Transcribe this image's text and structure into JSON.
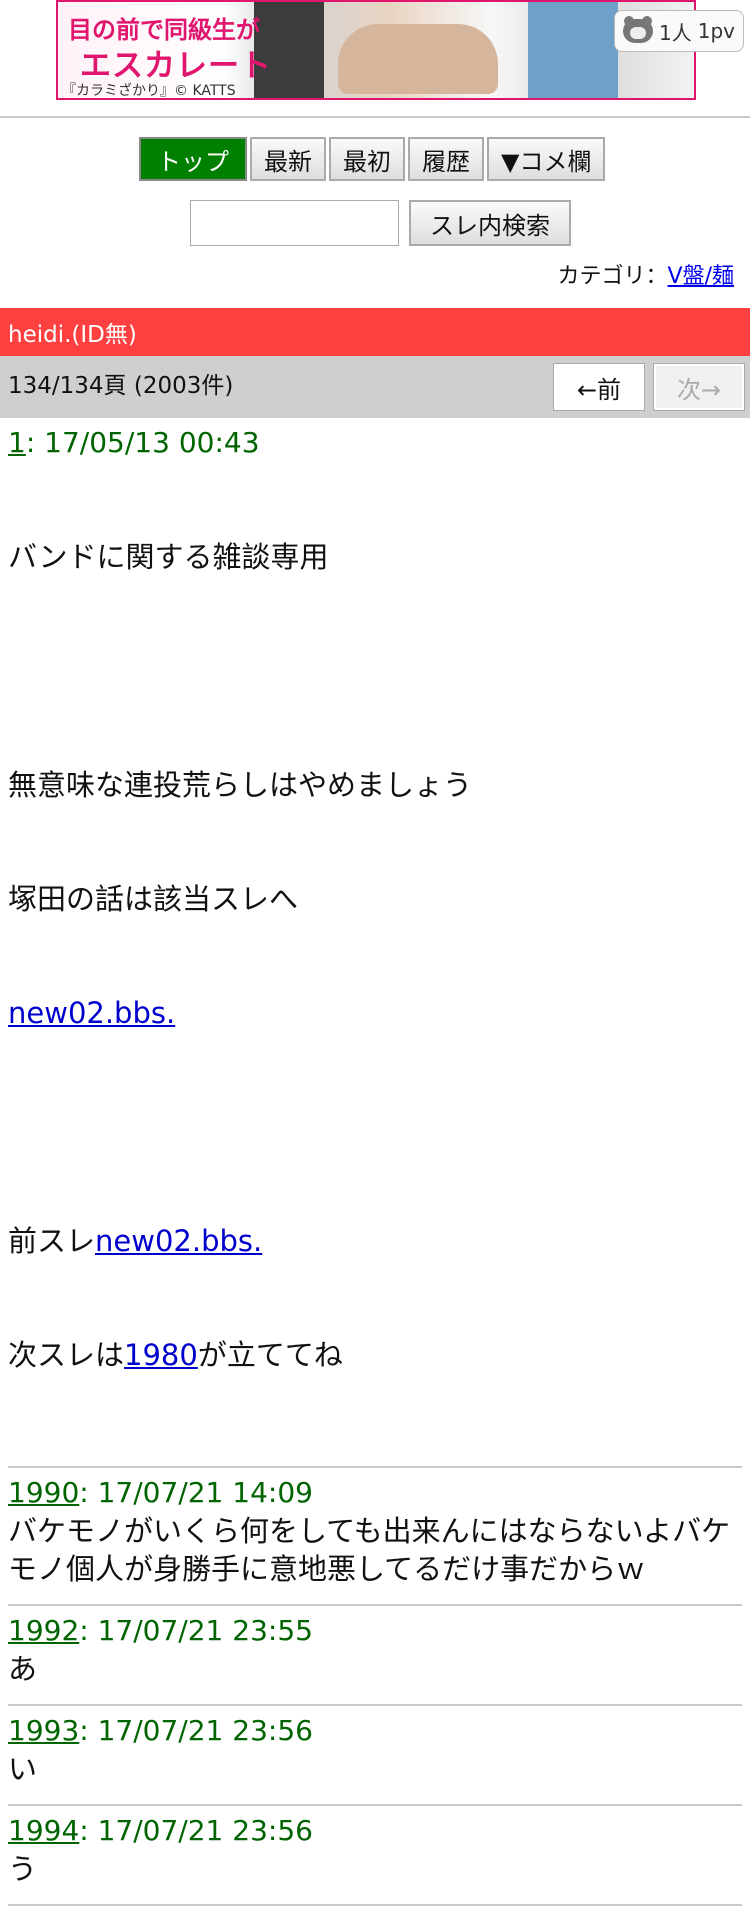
{
  "ad": {
    "line1": "目の前で同級生が",
    "line2": "エスカレート",
    "credit": "『カラミざかり』© KATTS"
  },
  "counter": {
    "people": "1人",
    "pv": "1pv",
    "icon": "bear-icon"
  },
  "nav": {
    "top": "トップ",
    "latest": "最新",
    "first": "最初",
    "history": "履歴",
    "comment": "▼コメ欄"
  },
  "search": {
    "placeholder": "",
    "button": "スレ内検索"
  },
  "category": {
    "label": "カテゴリ：",
    "link": "V盤/麺"
  },
  "thread": {
    "title": "heidi.(ID無)"
  },
  "pager": {
    "info": "134/134頁 (2003件)",
    "prev": "←前",
    "next": "次→"
  },
  "posts": [
    {
      "num": "1",
      "date": ": 17/05/13 00:43",
      "lines": [
        "バンドに関する雑談専用",
        "",
        "無意味な連投荒らしはやめましょう",
        "塚田の話は該当スレへ"
      ],
      "link1": "new02.bbs.",
      "prev_prefix": "前スレ",
      "link2": "new02.bbs.",
      "next_prefix": "次スレは",
      "link3": "1980",
      "next_suffix": "が立ててね"
    },
    {
      "num": "1990",
      "date": ": 17/07/21 14:09",
      "text": "バケモノがいくら何をしても出来んにはならないよバケモノ個人が身勝手に意地悪してるだけ事だからｗ"
    },
    {
      "num": "1992",
      "date": ": 17/07/21 23:55",
      "text": "あ"
    },
    {
      "num": "1993",
      "date": ": 17/07/21 23:56",
      "text": "い"
    },
    {
      "num": "1994",
      "date": ": 17/07/21 23:56",
      "text": "う"
    }
  ],
  "colors": {
    "title_bg": "#ff4040",
    "active_tab": "#008000",
    "post_head": "#006400",
    "link": "#0000cc"
  }
}
